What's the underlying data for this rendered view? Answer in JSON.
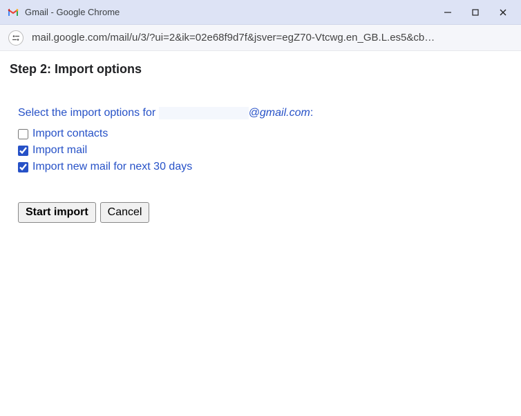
{
  "window": {
    "title": "Gmail - Google Chrome"
  },
  "addressbar": {
    "url": "mail.google.com/mail/u/3/?ui=2&ik=02e68f9d7f&jsver=egZ70-Vtcwg.en_GB.L.es5&cb…"
  },
  "page": {
    "heading": "Step 2: Import options",
    "prompt_prefix": "Select the import options for ",
    "prompt_suffix": "@gmail.com",
    "prompt_colon": ":",
    "options": [
      {
        "label": "Import contacts",
        "checked": false
      },
      {
        "label": "Import mail",
        "checked": true
      },
      {
        "label": "Import new mail for next 30 days",
        "checked": true
      }
    ],
    "buttons": {
      "start": "Start import",
      "cancel": "Cancel"
    }
  }
}
